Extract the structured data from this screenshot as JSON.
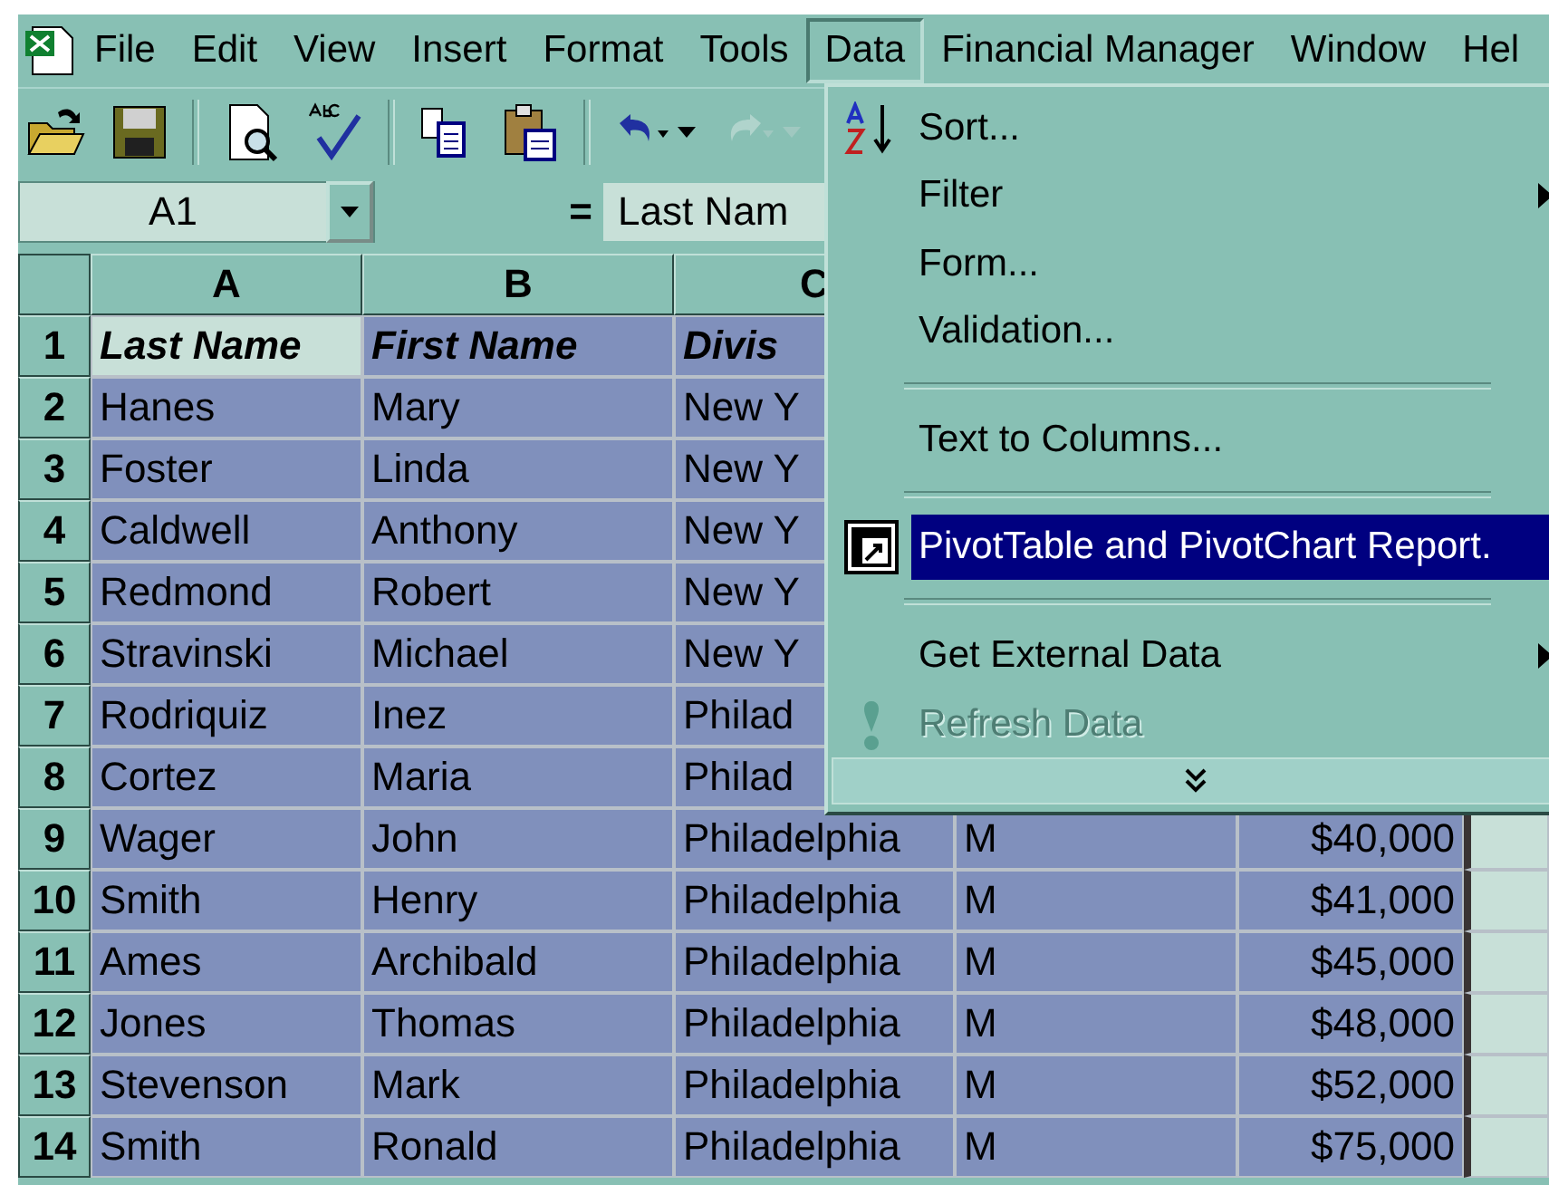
{
  "menu_bar": [
    {
      "label": "File",
      "selected": false
    },
    {
      "label": "Edit",
      "selected": false
    },
    {
      "label": "View",
      "selected": false
    },
    {
      "label": "Insert",
      "selected": false
    },
    {
      "label": "Format",
      "selected": false
    },
    {
      "label": "Tools",
      "selected": false
    },
    {
      "label": "Data",
      "selected": true
    },
    {
      "label": "Financial Manager",
      "selected": false
    },
    {
      "label": "Window",
      "selected": false
    },
    {
      "label": "Hel",
      "selected": false
    }
  ],
  "toolbar": [
    {
      "kind": "open"
    },
    {
      "kind": "save"
    },
    {
      "kind": "sep"
    },
    {
      "kind": "preview"
    },
    {
      "kind": "spelling"
    },
    {
      "kind": "sep"
    },
    {
      "kind": "copy"
    },
    {
      "kind": "paste"
    },
    {
      "kind": "sep"
    },
    {
      "kind": "undo",
      "disabled": false
    },
    {
      "kind": "redo",
      "disabled": true
    }
  ],
  "formula_bar": {
    "name_box": "A1",
    "equals": "=",
    "formula": "Last Nam"
  },
  "sheet": {
    "columns": [
      "A",
      "B",
      "C"
    ],
    "rows": [
      {
        "number": "1",
        "cells": [
          {
            "text": "Last Name",
            "active": true
          },
          {
            "text": "First Name",
            "active": false
          },
          {
            "text": "Divis",
            "active": false
          }
        ]
      },
      {
        "number": "2",
        "cells": [
          {
            "text": "Hanes",
            "active": false
          },
          {
            "text": "Mary",
            "active": false
          },
          {
            "text": "New Y",
            "active": false
          }
        ]
      },
      {
        "number": "3",
        "cells": [
          {
            "text": "Foster",
            "active": false
          },
          {
            "text": "Linda",
            "active": false
          },
          {
            "text": "New Y",
            "active": false
          }
        ]
      },
      {
        "number": "4",
        "cells": [
          {
            "text": "Caldwell",
            "active": false
          },
          {
            "text": "Anthony",
            "active": false
          },
          {
            "text": "New Y",
            "active": false
          }
        ]
      },
      {
        "number": "5",
        "cells": [
          {
            "text": "Redmond",
            "active": false
          },
          {
            "text": "Robert",
            "active": false
          },
          {
            "text": "New Y",
            "active": false
          }
        ]
      },
      {
        "number": "6",
        "cells": [
          {
            "text": "Stravinski",
            "active": false
          },
          {
            "text": "Michael",
            "active": false
          },
          {
            "text": "New Y",
            "active": false
          }
        ]
      },
      {
        "number": "7",
        "cells": [
          {
            "text": "Rodriquiz",
            "active": false
          },
          {
            "text": "Inez",
            "active": false
          },
          {
            "text": "Philad",
            "active": false
          }
        ]
      },
      {
        "number": "8",
        "cells": [
          {
            "text": "Cortez",
            "active": false
          },
          {
            "text": "Maria",
            "active": false
          },
          {
            "text": "Philad",
            "active": false
          }
        ]
      },
      {
        "number": "9",
        "cells": [
          {
            "text": "Wager",
            "active": false
          },
          {
            "text": "John",
            "active": false
          },
          {
            "text": "Philadelphia",
            "active": false
          },
          {
            "text": "M",
            "active": false
          },
          {
            "text": "$40,000",
            "active": false
          }
        ]
      },
      {
        "number": "10",
        "cells": [
          {
            "text": "Smith",
            "active": false
          },
          {
            "text": "Henry",
            "active": false
          },
          {
            "text": "Philadelphia",
            "active": false
          },
          {
            "text": "M",
            "active": false
          },
          {
            "text": "$41,000",
            "active": false
          }
        ]
      },
      {
        "number": "11",
        "cells": [
          {
            "text": "Ames",
            "active": false
          },
          {
            "text": "Archibald",
            "active": false
          },
          {
            "text": "Philadelphia",
            "active": false
          },
          {
            "text": "M",
            "active": false
          },
          {
            "text": "$45,000",
            "active": false
          }
        ]
      },
      {
        "number": "12",
        "cells": [
          {
            "text": "Jones",
            "active": false
          },
          {
            "text": "Thomas",
            "active": false
          },
          {
            "text": "Philadelphia",
            "active": false
          },
          {
            "text": "M",
            "active": false
          },
          {
            "text": "$48,000",
            "active": false
          }
        ]
      },
      {
        "number": "13",
        "cells": [
          {
            "text": "Stevenson",
            "active": false
          },
          {
            "text": "Mark",
            "active": false
          },
          {
            "text": "Philadelphia",
            "active": false
          },
          {
            "text": "M",
            "active": false
          },
          {
            "text": "$52,000",
            "active": false
          }
        ]
      },
      {
        "number": "14",
        "cells": [
          {
            "text": "Smith",
            "active": false
          },
          {
            "text": "Ronald",
            "active": false
          },
          {
            "text": "Philadelphia",
            "active": false
          },
          {
            "text": "M",
            "active": false
          },
          {
            "text": "$75,000",
            "active": false
          }
        ]
      }
    ]
  },
  "data_menu": [
    {
      "kind": "item",
      "label": "Sort...",
      "selected": false,
      "disabled": false,
      "submenu": false
    },
    {
      "kind": "item",
      "label": "Filter",
      "selected": false,
      "disabled": false,
      "submenu": true
    },
    {
      "kind": "item",
      "label": "Form...",
      "selected": false,
      "disabled": false,
      "submenu": false
    },
    {
      "kind": "item",
      "label": "Validation...",
      "selected": false,
      "disabled": false,
      "submenu": false
    },
    {
      "kind": "separator"
    },
    {
      "kind": "item",
      "label": "Text to Columns...",
      "selected": false,
      "disabled": false,
      "submenu": false
    },
    {
      "kind": "separator"
    },
    {
      "kind": "item",
      "label": "PivotTable and PivotChart Report.",
      "selected": true,
      "disabled": false,
      "submenu": false
    },
    {
      "kind": "separator"
    },
    {
      "kind": "item",
      "label": "Get External Data",
      "selected": false,
      "disabled": false,
      "submenu": true
    },
    {
      "kind": "item",
      "label": "Refresh Data",
      "selected": false,
      "disabled": true,
      "submenu": false
    },
    {
      "kind": "expand"
    }
  ]
}
